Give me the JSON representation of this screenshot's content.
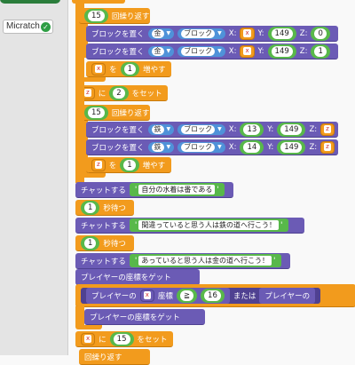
{
  "sidebar": {
    "extension_label": "Micratch"
  },
  "blocks": {
    "repeat1_count": "15",
    "repeat_label": "回繰り返す",
    "place_label": "ブロックを置く",
    "block_gold": "金",
    "block_iron": "鉄",
    "block_type_word": "ブロック",
    "x_label": "X:",
    "y_label": "Y:",
    "z_label": "Z:",
    "place1": {
      "x": "x",
      "y": "149",
      "z": "0"
    },
    "place2": {
      "x": "x",
      "y": "149",
      "z": "1"
    },
    "incr_var": "x",
    "incr_wo": "を",
    "incr_amount": "1",
    "incr_label": "増やす",
    "set_var": "z",
    "set_ni": "に",
    "set_value": "2",
    "set_label": "をセット",
    "repeat2_count": "15",
    "place3": {
      "x": "13",
      "y": "149",
      "z": "z"
    },
    "place4": {
      "x": "14",
      "y": "149",
      "z": "z"
    },
    "incr2_var": "z",
    "incr2_amount": "1",
    "chat_label": "チャットする",
    "chat1": "自分の水着は番である",
    "wait1": "1",
    "wait_label": "秒待つ",
    "chat2": "間違っていると思う人は鉄の道へ行こう！",
    "wait2": "1",
    "chat3": "あっていると思う人は金の道へ行こう！",
    "get_pos_label": "プレイヤーの座標をゲット",
    "player_label": "プレイヤーの",
    "coord_var": "x",
    "coord_label": "座標",
    "compare_op": "≧",
    "compare_val": "16",
    "or_label": "または",
    "player_label2": "プレイヤーの",
    "get_pos_label2": "プレイヤーの座標をゲット",
    "set2_var": "x",
    "set2_ni": "に",
    "set2_value": "15",
    "set2_label": "をセット",
    "repeat3_label": "回繰り返す"
  },
  "colors": {
    "loop": "#f29b1d",
    "minecraft": "#6b5bb5",
    "number": "#58b84a",
    "dropdown": "#4f92d9"
  }
}
